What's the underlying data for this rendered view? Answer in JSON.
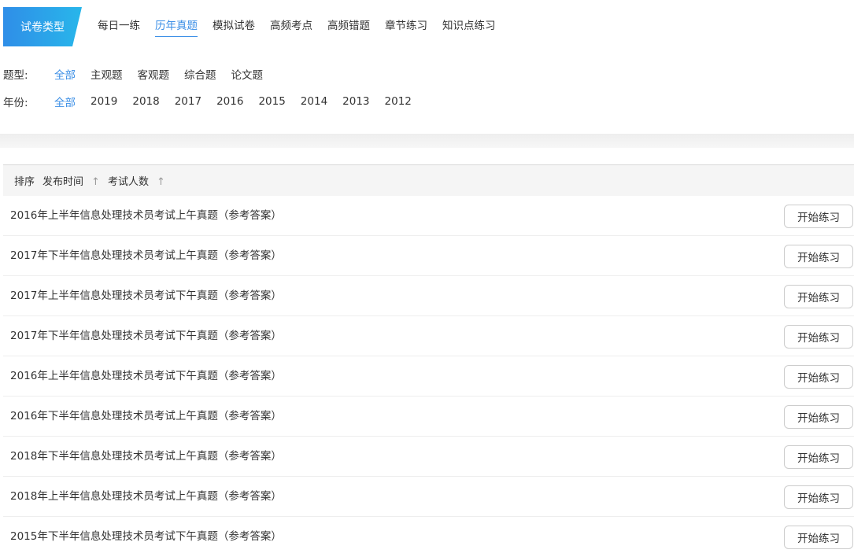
{
  "filter": {
    "type_label": "试卷类型",
    "tabs": [
      {
        "label": "每日一练",
        "active": false
      },
      {
        "label": "历年真题",
        "active": true
      },
      {
        "label": "模拟试卷",
        "active": false
      },
      {
        "label": "高频考点",
        "active": false
      },
      {
        "label": "高频错题",
        "active": false
      },
      {
        "label": "章节练习",
        "active": false
      },
      {
        "label": "知识点练习",
        "active": false
      }
    ],
    "question_type": {
      "label": "题型:",
      "options": [
        "全部",
        "主观题",
        "客观题",
        "综合题",
        "论文题"
      ],
      "selected": "全部"
    },
    "year": {
      "label": "年份:",
      "options": [
        "全部",
        "2019",
        "2018",
        "2017",
        "2016",
        "2015",
        "2014",
        "2013",
        "2012"
      ],
      "selected": "全部"
    }
  },
  "sort": {
    "title": "排序",
    "publish_time": "发布时间",
    "participants": "考试人数",
    "arrow": "↑"
  },
  "exams": [
    {
      "title": "2016年上半年信息处理技术员考试上午真题（参考答案）",
      "button": "开始练习"
    },
    {
      "title": "2017年下半年信息处理技术员考试上午真题（参考答案）",
      "button": "开始练习"
    },
    {
      "title": "2017年上半年信息处理技术员考试下午真题（参考答案）",
      "button": "开始练习"
    },
    {
      "title": "2017年下半年信息处理技术员考试下午真题（参考答案）",
      "button": "开始练习"
    },
    {
      "title": "2016年上半年信息处理技术员考试下午真题（参考答案）",
      "button": "开始练习"
    },
    {
      "title": "2016年下半年信息处理技术员考试上午真题（参考答案）",
      "button": "开始练习"
    },
    {
      "title": "2018年下半年信息处理技术员考试上午真题（参考答案）",
      "button": "开始练习"
    },
    {
      "title": "2018年上半年信息处理技术员考试上午真题（参考答案）",
      "button": "开始练习"
    },
    {
      "title": "2015年下半年信息处理技术员考试下午真题（参考答案）",
      "button": "开始练习"
    }
  ]
}
